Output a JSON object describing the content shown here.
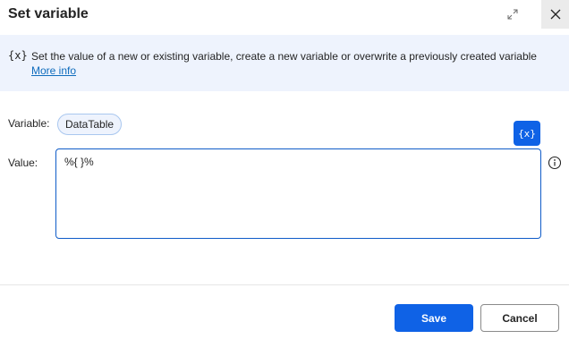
{
  "dialog": {
    "title": "Set variable"
  },
  "banner": {
    "icon_text": "{x}",
    "description": "Set the value of a new or existing variable, create a new variable or overwrite a previously created variable",
    "more_info_label": "More info"
  },
  "form": {
    "variable_label": "Variable:",
    "variable_name": "DataTable",
    "value_label": "Value:",
    "value_text": "%{ }%",
    "variable_picker_label": "{x}"
  },
  "footer": {
    "save_label": "Save",
    "cancel_label": "Cancel"
  },
  "colors": {
    "accent": "#0f62e6",
    "banner_bg": "#eef3fd",
    "link": "#0f6cbd"
  },
  "icons": {
    "expand": "expand-icon",
    "close": "close-icon",
    "info": "info-icon"
  }
}
